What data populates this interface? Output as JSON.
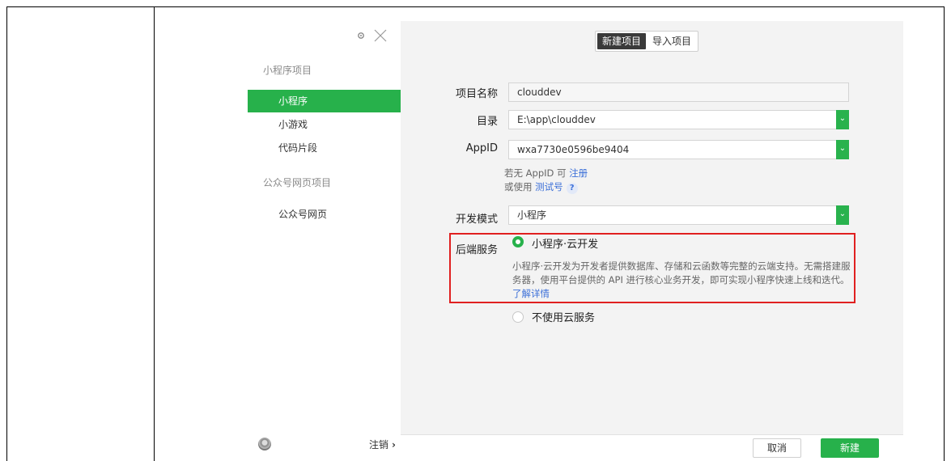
{
  "sidebar": {
    "section_miniprogram": "小程序项目",
    "items_miniprogram": [
      {
        "label": "小程序",
        "active": true
      },
      {
        "label": "小游戏",
        "active": false
      },
      {
        "label": "代码片段",
        "active": false
      }
    ],
    "section_official": "公众号网页项目",
    "items_official": [
      {
        "label": "公众号网页",
        "active": false
      }
    ],
    "logout_label": "注销",
    "icons": {
      "settings": "gear-icon",
      "close": "close-icon",
      "avatar": "avatar"
    }
  },
  "tabs": [
    {
      "label": "新建项目",
      "active": true
    },
    {
      "label": "导入项目",
      "active": false
    }
  ],
  "form": {
    "project_name": {
      "label": "项目名称",
      "value": "clouddev"
    },
    "directory": {
      "label": "目录",
      "value": "E:\\app\\clouddev"
    },
    "appid": {
      "label": "AppID",
      "value": "wxa7730e0596be9404"
    },
    "appid_hint": {
      "line1_prefix": "若无 AppID 可 ",
      "line1_link": "注册",
      "line2_prefix": "或使用 ",
      "line2_link": "测试号",
      "help": "?"
    },
    "dev_mode": {
      "label": "开发模式",
      "value": "小程序"
    },
    "backend": {
      "label": "后端服务",
      "option_cloud": {
        "title": "小程序·云开发",
        "selected": true,
        "description": "小程序·云开发为开发者提供数据库、存储和云函数等完整的云端支持。无需搭建服务器，使用平台提供的 API 进行核心业务开发，即可实现小程序快速上线和迭代。",
        "link": "了解详情"
      },
      "option_none": {
        "title": "不使用云服务",
        "selected": false
      }
    }
  },
  "footer": {
    "cancel_label": "取消",
    "create_label": "新建"
  },
  "colors": {
    "accent": "#27b14b",
    "highlight_border": "#e02020",
    "link": "#3b6fd8"
  }
}
